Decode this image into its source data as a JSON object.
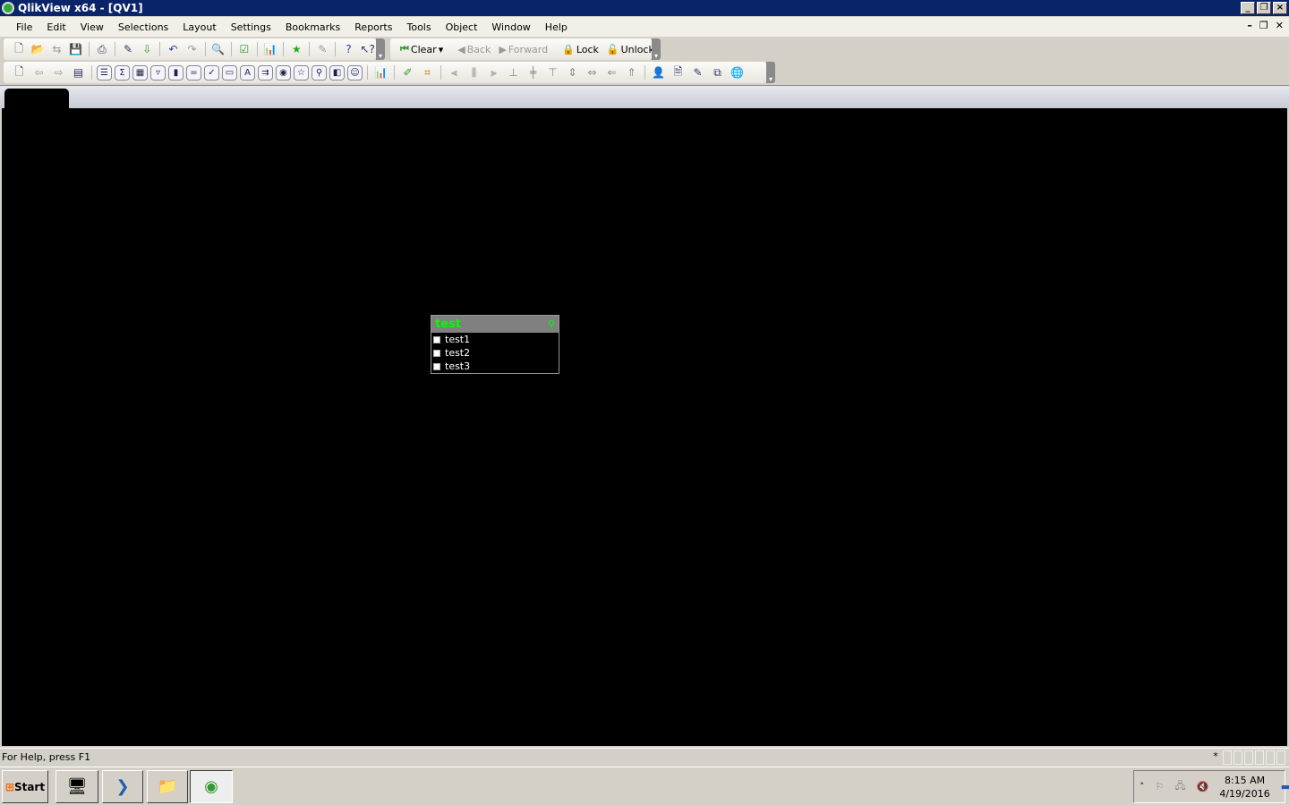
{
  "window": {
    "title": "QlikView x64 - [QV1]"
  },
  "menu": [
    "File",
    "Edit",
    "View",
    "Selections",
    "Layout",
    "Settings",
    "Bookmarks",
    "Reports",
    "Tools",
    "Object",
    "Window",
    "Help"
  ],
  "toolbar1": {
    "clear": "Clear",
    "back": "Back",
    "forward": "Forward",
    "lock": "Lock",
    "unlock": "Unlock"
  },
  "listbox": {
    "title": "test",
    "items": [
      "test1",
      "test2",
      "test3"
    ],
    "title_color": "#00ff00"
  },
  "status": {
    "help": "For Help, press F1",
    "indicator": "*"
  },
  "taskbar": {
    "start": "Start",
    "time": "8:15 AM",
    "date": "4/19/2016"
  }
}
